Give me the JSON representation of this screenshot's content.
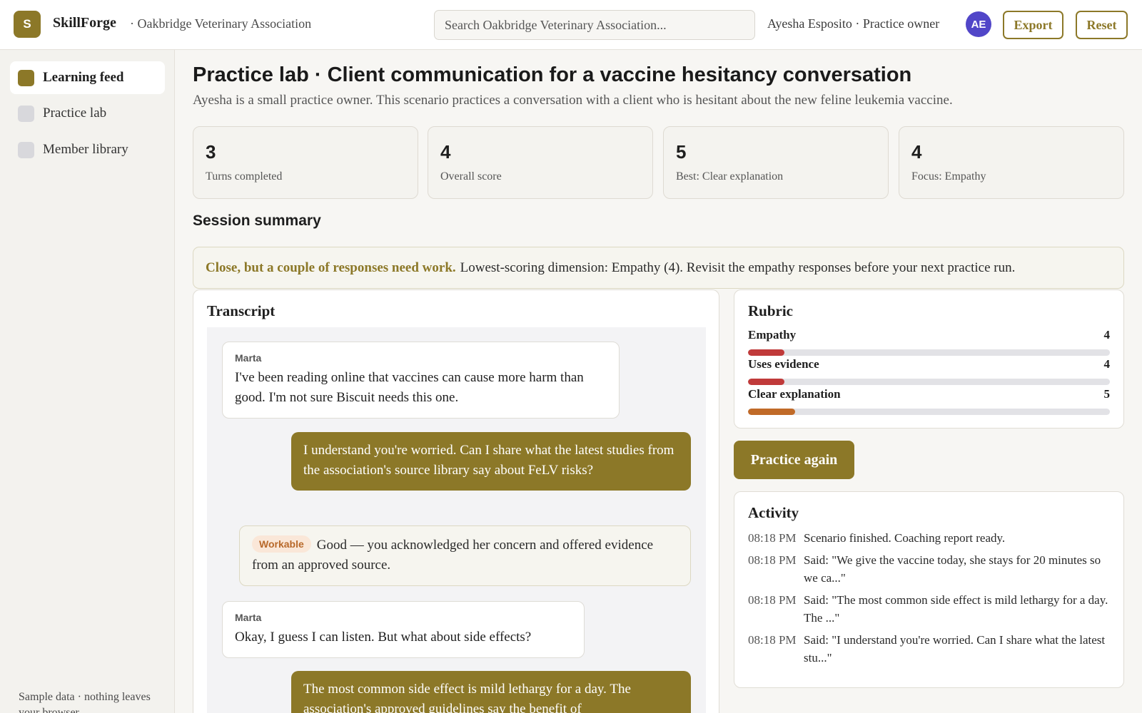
{
  "app": {
    "logo_letter": "S",
    "brand": "SkillForge",
    "org": "· Oakbridge Veterinary Association",
    "search_placeholder": "Search Oakbridge Veterinary Association...",
    "user": "Ayesha Esposito · Practice owner",
    "avatar": "AE",
    "export_label": "Export",
    "reset_label": "Reset"
  },
  "sidebar": {
    "items": [
      {
        "label": "Learning feed",
        "active": true
      },
      {
        "label": "Practice lab",
        "active": false
      },
      {
        "label": "Member library",
        "active": false
      }
    ],
    "footer": "Sample data · nothing leaves your browser."
  },
  "page": {
    "title": "Practice lab · Client communication for a vaccine hesitancy conversation",
    "subtitle": "Ayesha is a small practice owner. This scenario practices a conversation with a client who is hesitant about the new feline leukemia vaccine."
  },
  "stats": [
    {
      "value": "3",
      "label": "Turns completed"
    },
    {
      "value": "4",
      "label": "Overall score"
    },
    {
      "value": "5",
      "label": "Best: Clear explanation"
    },
    {
      "value": "4",
      "label": "Focus: Empathy"
    }
  ],
  "summary": {
    "heading": "Session summary",
    "strong": "Close, but a couple of responses need work.",
    "text": "Lowest-scoring dimension: Empathy (4). Revisit the empathy responses before your next practice run."
  },
  "transcript": {
    "title": "Transcript",
    "messages": [
      {
        "who": "Marta",
        "text": "I've been reading online that vaccines can cause more harm than good. I'm not sure Biscuit needs this one."
      },
      {
        "text": "I understand you're worried. Can I share what the latest studies from the association's source library say about FeLV risks?"
      },
      {
        "tag": "Workable",
        "text": "Good — you acknowledged her concern and offered evidence from an approved source."
      },
      {
        "who": "Marta",
        "text": "Okay, I guess I can listen. But what about side effects?"
      },
      {
        "text": "The most common side effect is mild lethargy for a day. The association's approved guidelines say the benefit of"
      }
    ]
  },
  "rubric": {
    "title": "Rubric",
    "scale_max": 10,
    "items": [
      {
        "label": "Empathy",
        "value": "4",
        "fill": 0.1,
        "color": "#c03a3a"
      },
      {
        "label": "Uses evidence",
        "value": "4",
        "fill": 0.1,
        "color": "#c03a3a"
      },
      {
        "label": "Clear explanation",
        "value": "5",
        "fill": 0.13,
        "color": "#c06a28"
      }
    ]
  },
  "practice_again_label": "Practice again",
  "activity": {
    "title": "Activity",
    "items": [
      {
        "time": "08:18 PM",
        "text": "Scenario finished. Coaching report ready."
      },
      {
        "time": "08:18 PM",
        "text": "Said: \"We give the vaccine today, she stays for 20 minutes so we ca...\""
      },
      {
        "time": "08:18 PM",
        "text": "Said: \"The most common side effect is mild lethargy for a day. The ...\""
      },
      {
        "time": "08:18 PM",
        "text": "Said: \"I understand you're worried. Can I share what the latest stu...\""
      }
    ]
  },
  "colors": {
    "accent": "#8c7828",
    "avatar": "#5146c8",
    "low_score": "#c03a3a",
    "mid_score": "#c06a28"
  }
}
